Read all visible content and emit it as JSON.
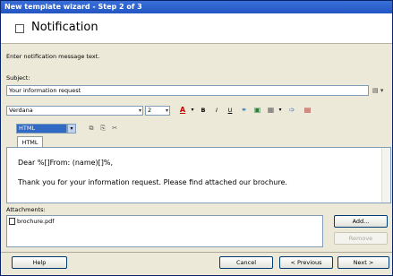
{
  "window": {
    "title": "New template wizard - Step 2 of 3"
  },
  "header": {
    "title": "Notification"
  },
  "intro": "Enter notification message text.",
  "subject": {
    "label": "Subject:",
    "value": "Your information request",
    "menu": "▤ ▾"
  },
  "toolbar": {
    "font": "Verdana",
    "size": "2",
    "font_color": "A",
    "bold": "B",
    "italic": "I",
    "underline": "U",
    "mode": "HTML"
  },
  "tab": {
    "label": "HTML"
  },
  "editor": {
    "line1": "Dear %[]From: (name)[]%,",
    "line2": "Thank you for your information request. Please find attached our brochure."
  },
  "attachments": {
    "label": "Attachments:",
    "items": [
      {
        "name": "brochure.pdf"
      }
    ],
    "add_label": "Add...",
    "remove_label": "Remove"
  },
  "footer": {
    "help": "Help",
    "cancel": "Cancel",
    "previous": "< Previous",
    "next": "Next >"
  }
}
